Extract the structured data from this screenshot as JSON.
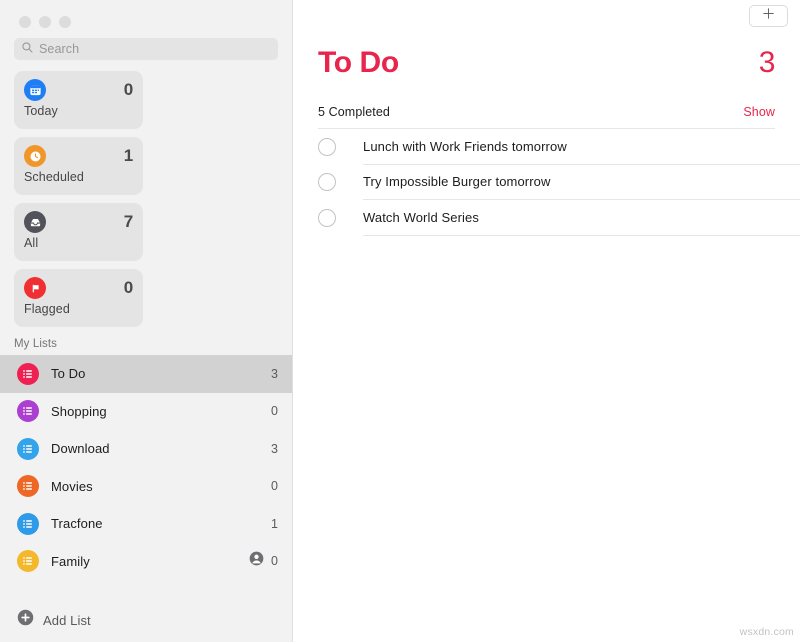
{
  "window": {
    "traffic_lights": [
      "close",
      "minimize",
      "zoom"
    ]
  },
  "sidebar": {
    "search": {
      "placeholder": "Search",
      "value": "",
      "icon": "search-icon"
    },
    "smart_cards": [
      {
        "label": "Today",
        "count": "0",
        "icon": "calendar-icon",
        "color": "#1f7ef6"
      },
      {
        "label": "Scheduled",
        "count": "1",
        "icon": "clock-icon",
        "color": "#f0962a"
      },
      {
        "label": "All",
        "count": "7",
        "icon": "inbox-icon",
        "color": "#52525a"
      },
      {
        "label": "Flagged",
        "count": "0",
        "icon": "flag-icon",
        "color": "#f02f32"
      }
    ],
    "lists_header": "My Lists",
    "lists": [
      {
        "name": "To Do",
        "count": "3",
        "color": "#ef2152",
        "selected": true,
        "shared": false
      },
      {
        "name": "Shopping",
        "count": "0",
        "color": "#ab3fd0",
        "selected": false,
        "shared": false
      },
      {
        "name": "Download",
        "count": "3",
        "color": "#33a3ec",
        "selected": false,
        "shared": false
      },
      {
        "name": "Movies",
        "count": "0",
        "color": "#ef6724",
        "selected": false,
        "shared": false
      },
      {
        "name": "Tracfone",
        "count": "1",
        "color": "#2e9ae8",
        "selected": false,
        "shared": false
      },
      {
        "name": "Family",
        "count": "0",
        "color": "#f3b82c",
        "selected": false,
        "shared": true
      }
    ],
    "add_list": {
      "label": "Add List",
      "icon": "plus-circle-icon"
    }
  },
  "main": {
    "toolbar": {
      "add_button_icon": "plus-icon"
    },
    "title": "To Do",
    "title_count": "3",
    "accent_color": "#e8254d",
    "completed_text": "5 Completed",
    "show_label": "Show",
    "reminders": [
      {
        "text": "Lunch with Work Friends tomorrow",
        "done": false
      },
      {
        "text": "Try Impossible Burger tomorrow",
        "done": false
      },
      {
        "text": "Watch World Series",
        "done": false
      }
    ]
  },
  "watermark": "wsxdn.com"
}
